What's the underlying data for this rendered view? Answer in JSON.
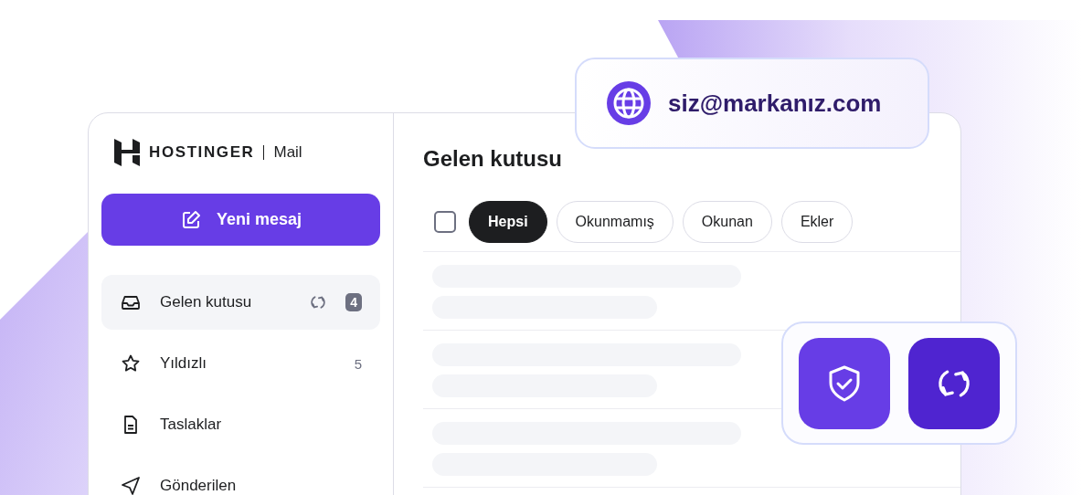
{
  "brand": {
    "name": "HOSTINGER",
    "product": "Mail"
  },
  "compose_button": {
    "label": "Yeni mesaj"
  },
  "folders": [
    {
      "kind": "inbox",
      "label": "Gelen kutusu",
      "selected": true,
      "syncing": true,
      "count": "4"
    },
    {
      "kind": "star",
      "label": "Yıldızlı",
      "selected": false,
      "syncing": false,
      "count": "5"
    },
    {
      "kind": "draft",
      "label": "Taslaklar",
      "selected": false,
      "syncing": false
    },
    {
      "kind": "sent",
      "label": "Gönderilen",
      "selected": false,
      "syncing": false
    }
  ],
  "main": {
    "title": "Gelen kutusu",
    "select_all": {
      "checked": false
    },
    "filters": [
      {
        "label": "Hepsi",
        "selected": true
      },
      {
        "label": "Okunmamış",
        "selected": false
      },
      {
        "label": "Okunan",
        "selected": false
      },
      {
        "label": "Ekler",
        "selected": false
      }
    ],
    "message_list": {
      "loading": true
    }
  },
  "address_badge": {
    "address": "siz@markanız.com"
  }
}
